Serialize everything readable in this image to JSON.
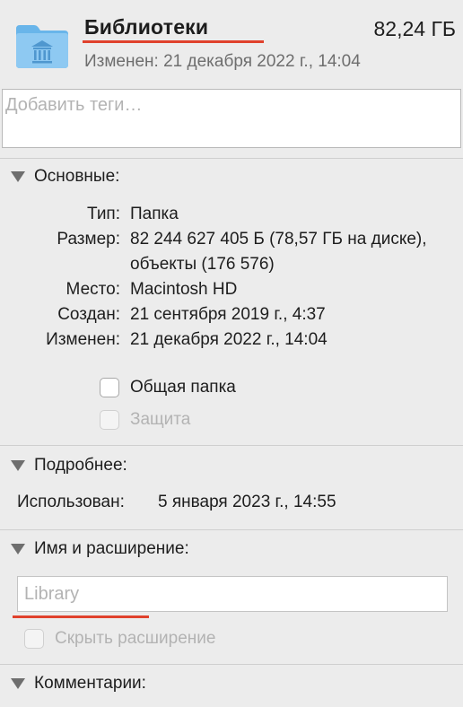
{
  "header": {
    "title": "Библиотеки",
    "size": "82,24 ГБ",
    "modified": "Изменен: 21 декабря 2022 г., 14:04",
    "icon": "library-folder-icon",
    "accent_color": "#e0412c"
  },
  "tags": {
    "placeholder": "Добавить теги…"
  },
  "general": {
    "heading": "Основные:",
    "rows": [
      {
        "label": "Тип:",
        "value": "Папка"
      },
      {
        "label": "Размер:",
        "value": "82 244 627 405 Б (78,57 ГБ на диске), объекты (176 576)"
      },
      {
        "label": "Место:",
        "value": "Macintosh HD"
      },
      {
        "label": "Создан:",
        "value": "21 сентября 2019 г., 4:37"
      },
      {
        "label": "Изменен:",
        "value": "21 декабря 2022 г., 14:04"
      }
    ],
    "shared_folder_label": "Общая папка",
    "locked_label": "Защита"
  },
  "more_info": {
    "heading": "Подробнее:",
    "last_opened_label": "Использован:",
    "last_opened_value": "5 января 2023 г., 14:55"
  },
  "name_extension": {
    "heading": "Имя и расширение:",
    "name_placeholder": "Library",
    "hide_extension_label": "Скрыть расширение"
  },
  "comments": {
    "heading": "Комментарии:"
  }
}
